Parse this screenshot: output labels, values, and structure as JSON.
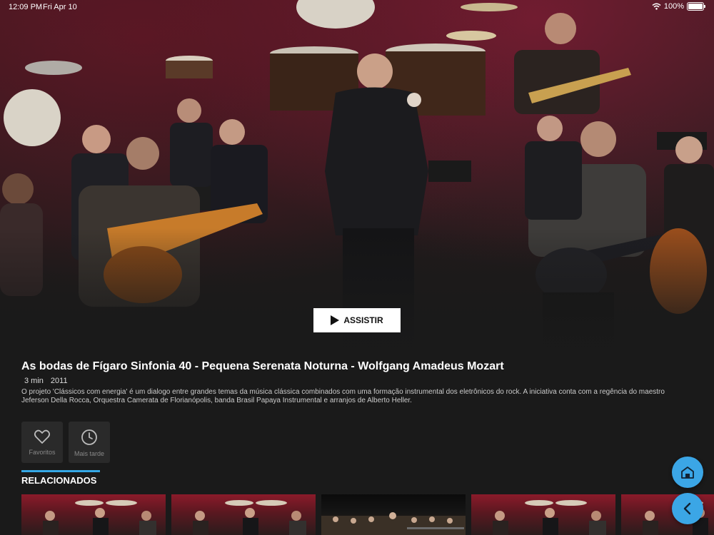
{
  "status_bar": {
    "time": "12:09 PM",
    "date": "Fri Apr 10",
    "battery": "100%"
  },
  "hero": {
    "play_label": "ASSISTIR"
  },
  "content": {
    "title": "As bodas de Fígaro Sinfonia 40 - Pequena Serenata Noturna - Wolfgang Amadeus Mozart",
    "duration": "3 min",
    "year": "2011",
    "description": "O projeto 'Clássicos com energia' é um dialogo entre grandes temas da música clássica combinados com uma formação instrumental dos eletrônicos do rock. A iniciativa conta com a regência do maestro Jeferson Della Rocca, Orquestra Camerata de Florianópolis, banda Brasil Papaya Instrumental e arranjos de Alberto Heller."
  },
  "actions": {
    "favorites_label": "Favoritos",
    "later_label": "Mais tarde"
  },
  "related": {
    "tab_label": "RELACIONADOS",
    "accent_color": "#35a8e6"
  },
  "fab": {
    "color": "#3ba6e6",
    "home_icon": "home-icon",
    "back_icon": "chevron-left-icon"
  }
}
